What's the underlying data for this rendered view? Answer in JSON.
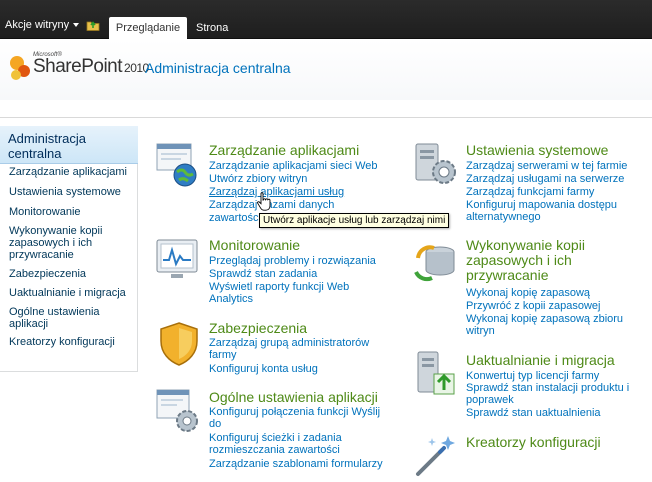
{
  "ribbon": {
    "site_actions": "Akcje witryny",
    "tab_browse": "Przeglądanie",
    "tab_page": "Strona"
  },
  "header": {
    "logo_microsoft": "Microsoft®",
    "logo_sharepoint": "SharePoint",
    "logo_version": "2010",
    "site_title": "Administracja centralna"
  },
  "quick_launch": {
    "heading": "Administracja centralna",
    "items": [
      "Zarządzanie aplikacjami",
      "Ustawienia systemowe",
      "Monitorowanie",
      "Wykonywanie kopii zapasowych i ich przywracanie",
      "Zabezpieczenia",
      "Uaktualnianie i migracja",
      "Ogólne ustawienia aplikacji",
      "Kreatorzy konfiguracji"
    ]
  },
  "sections": {
    "app_management": {
      "title": "Zarządzanie aplikacjami",
      "links": [
        "Zarządzanie aplikacjami sieci Web",
        "Utwórz zbiory witryn",
        "Zarządzaj aplikacjami usług",
        "Zarządzaj bazami danych",
        "zawartości"
      ]
    },
    "system_settings": {
      "title": "Ustawienia systemowe",
      "links": [
        "Zarządzaj serwerami w tej farmie",
        "Zarządzaj usługami na serwerze",
        "Zarządzaj funkcjami farmy",
        "Konfiguruj mapowania dostępu alternatywnego"
      ]
    },
    "monitoring": {
      "title": "Monitorowanie",
      "links": [
        "Przeglądaj problemy i rozwiązania",
        "Sprawdź stan zadania",
        "Wyświetl raporty funkcji Web Analytics"
      ]
    },
    "backup": {
      "title": "Wykonywanie kopii zapasowych i ich przywracanie",
      "links": [
        "Wykonaj kopię zapasową",
        "Przywróć z kopii zapasowej",
        "Wykonaj kopię zapasową zbioru witryn"
      ]
    },
    "security": {
      "title": "Zabezpieczenia",
      "links": [
        "Zarządzaj grupą administratorów farmy",
        "Konfiguruj konta usług"
      ]
    },
    "upgrade": {
      "title": "Uaktualnianie i migracja",
      "links": [
        "Konwertuj typ licencji farmy",
        "Sprawdź stan instalacji produktu i poprawek",
        "Sprawdź stan uaktualnienia"
      ]
    },
    "general": {
      "title": "Ogólne ustawienia aplikacji",
      "links": [
        "Konfiguruj połączenia funkcji Wyślij do",
        "Konfiguruj ścieżki i zadania rozmieszczania zawartości",
        "Zarządzanie szablonami formularzy"
      ]
    },
    "wizards": {
      "title": "Kreatorzy konfiguracji"
    }
  },
  "tooltip": "Utwórz aplikacje usług lub zarządzaj nimi"
}
